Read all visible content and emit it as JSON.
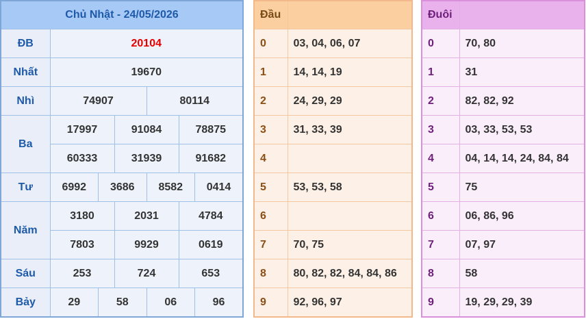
{
  "results": {
    "title": "Chủ Nhật - 24/05/2026",
    "prizes": {
      "db": {
        "label": "ĐB",
        "numbers": [
          "20104"
        ]
      },
      "nhat": {
        "label": "Nhất",
        "numbers": [
          "19670"
        ]
      },
      "nhi": {
        "label": "Nhì",
        "numbers": [
          "74907",
          "80114"
        ]
      },
      "ba": {
        "label": "Ba",
        "numbers": [
          "17997",
          "91084",
          "78875",
          "60333",
          "31939",
          "91682"
        ]
      },
      "tu": {
        "label": "Tư",
        "numbers": [
          "6992",
          "3686",
          "8582",
          "0414"
        ]
      },
      "nam": {
        "label": "Năm",
        "numbers": [
          "3180",
          "2031",
          "4784",
          "7803",
          "9929",
          "0619"
        ]
      },
      "sau": {
        "label": "Sáu",
        "numbers": [
          "253",
          "724",
          "653"
        ]
      },
      "bay": {
        "label": "Bảy",
        "numbers": [
          "29",
          "58",
          "06",
          "96"
        ]
      }
    }
  },
  "heads": {
    "header": "Đầu",
    "rows": [
      {
        "key": "0",
        "values": "03, 04, 06, 07"
      },
      {
        "key": "1",
        "values": "14, 14, 19"
      },
      {
        "key": "2",
        "values": "24, 29, 29"
      },
      {
        "key": "3",
        "values": "31, 33, 39"
      },
      {
        "key": "4",
        "values": ""
      },
      {
        "key": "5",
        "values": "53, 53, 58"
      },
      {
        "key": "6",
        "values": ""
      },
      {
        "key": "7",
        "values": "70, 75"
      },
      {
        "key": "8",
        "values": "80, 82, 82, 84, 84, 86"
      },
      {
        "key": "9",
        "values": "92, 96, 97"
      }
    ]
  },
  "tails": {
    "header": "Đuôi",
    "rows": [
      {
        "key": "0",
        "values": "70, 80"
      },
      {
        "key": "1",
        "values": "31"
      },
      {
        "key": "2",
        "values": "82, 82, 92"
      },
      {
        "key": "3",
        "values": "03, 33, 53, 53"
      },
      {
        "key": "4",
        "values": "04, 14, 14, 24, 84, 84"
      },
      {
        "key": "5",
        "values": "75"
      },
      {
        "key": "6",
        "values": "06, 86, 96"
      },
      {
        "key": "7",
        "values": "07, 97"
      },
      {
        "key": "8",
        "values": "58"
      },
      {
        "key": "9",
        "values": "19, 29, 29, 39"
      }
    ]
  },
  "colors": {
    "results_header_bg": "#a7c9f5",
    "results_text_blue": "#1e5aa8",
    "special_prize_red": "#e60000",
    "heads_header_bg": "#fbcf9f",
    "tails_header_bg": "#eab2ec"
  }
}
